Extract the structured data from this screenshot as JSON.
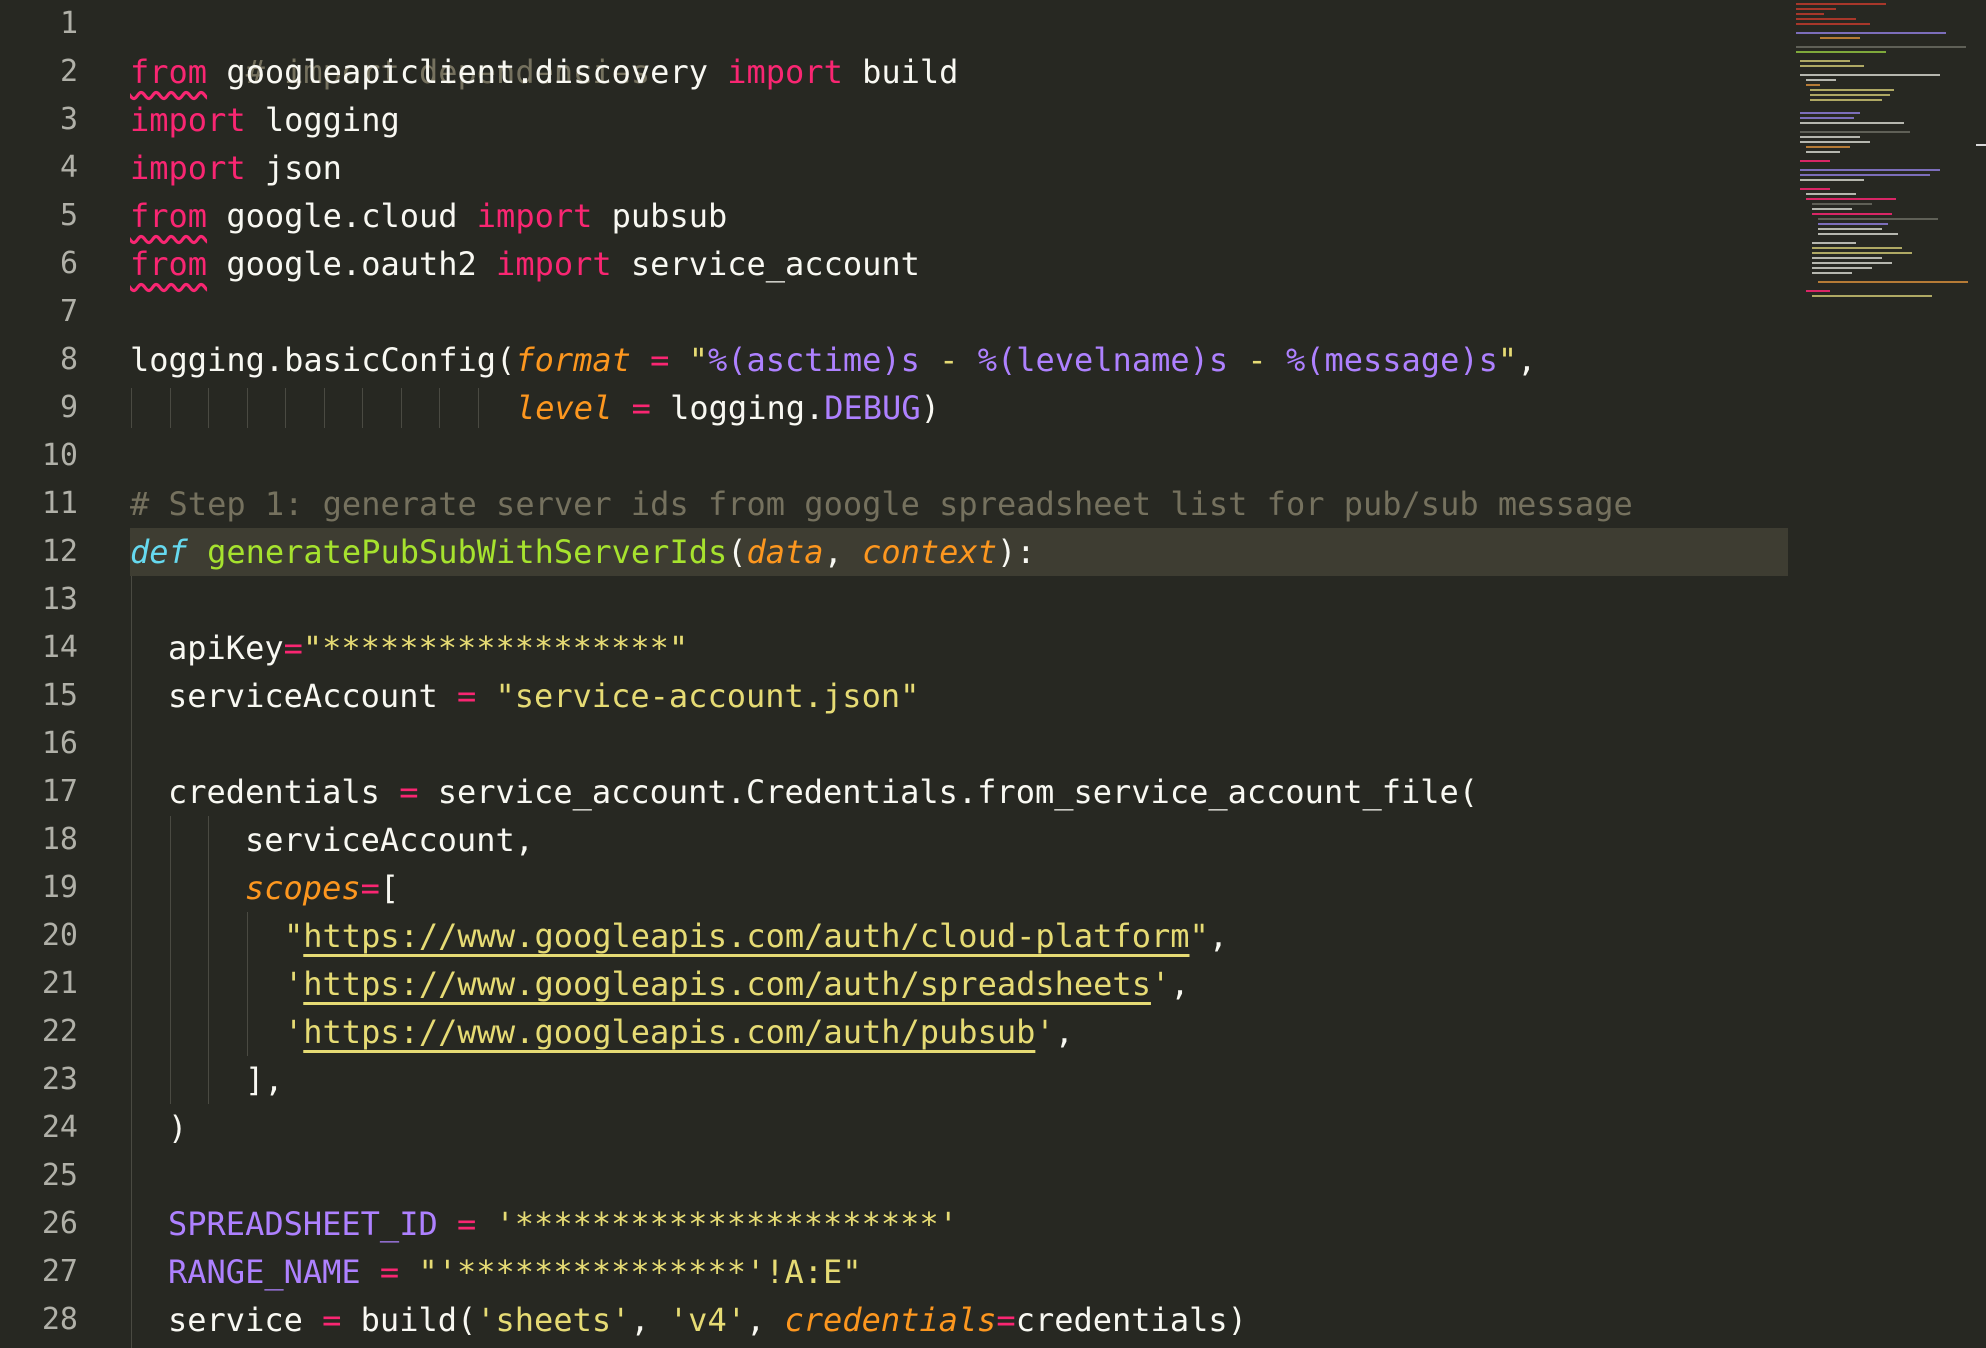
{
  "editor": {
    "language": "python",
    "theme": "monokai",
    "highlighted_line": 12
  },
  "gutter": {
    "line_numbers": [
      "1",
      "2",
      "3",
      "4",
      "5",
      "6",
      "7",
      "8",
      "9",
      "10",
      "11",
      "12",
      "13",
      "14",
      "15",
      "16",
      "17",
      "18",
      "19",
      "20",
      "21",
      "22",
      "23",
      "24",
      "25",
      "26",
      "27",
      "28"
    ]
  },
  "code": {
    "l1_comment": "# import dependencies",
    "l2": {
      "from": "from",
      "mod": " googleapiclient.discovery ",
      "import": "import",
      "name": " build"
    },
    "l3": {
      "import": "import",
      "name": " logging"
    },
    "l4": {
      "import": "import",
      "name": " json"
    },
    "l5": {
      "from": "from",
      "mod": " google.cloud ",
      "import": "import",
      "name": " pubsub"
    },
    "l6": {
      "from": "from",
      "mod": " google.oauth2 ",
      "import": "import",
      "name": " service_account"
    },
    "l8": {
      "call": "logging.basicConfig(",
      "param": "format",
      "eq": " = ",
      "q1": "\"",
      "fmt1": "%(asctime)s",
      "dash1": " - ",
      "fmt2": "%(levelname)s",
      "dash2": " - ",
      "fmt3": "%(message)s",
      "q2": "\"",
      "tail": ","
    },
    "l9": {
      "param": "level",
      "eq": " = ",
      "obj": "logging.",
      "const": "DEBUG",
      "tail": ")"
    },
    "l11_comment": "# Step 1: generate server ids from google spreadsheet list for pub/sub message",
    "l12": {
      "def": "def",
      "name": "generatePubSubWithServerIds",
      "open": "(",
      "p1": "data",
      "comma": ", ",
      "p2": "context",
      "close": "):"
    },
    "l14": {
      "var": "apiKey",
      "eq": "=",
      "str": "\"******************\""
    },
    "l15": {
      "var": "serviceAccount",
      "eq": " = ",
      "str": "\"service-account.json\""
    },
    "l17": {
      "var": "credentials",
      "eq": " = ",
      "call": "service_account.Credentials.from_service_account_file("
    },
    "l18": {
      "text": "serviceAccount,"
    },
    "l19": {
      "param": "scopes",
      "eq": "=",
      "tail": "["
    },
    "l20": {
      "q1": "\"",
      "url": "https://www.googleapis.com/auth/cloud-platform",
      "q2": "\"",
      "tail": ","
    },
    "l21": {
      "q1": "'",
      "url": "https://www.googleapis.com/auth/spreadsheets",
      "q2": "'",
      "tail": ","
    },
    "l22": {
      "q1": "'",
      "url": "https://www.googleapis.com/auth/pubsub",
      "q2": "'",
      "tail": ","
    },
    "l23": {
      "text": "],"
    },
    "l24": {
      "text": ")"
    },
    "l26": {
      "const": "SPREADSHEET_ID",
      "eq": " = ",
      "str": "'**********************'"
    },
    "l27": {
      "const": "RANGE_NAME",
      "eq": " = ",
      "str": "\"'***************'!A:E\""
    },
    "l28": {
      "var": "service",
      "eq": " = ",
      "call": "build(",
      "s1": "'sheets'",
      "c1": ", ",
      "s2": "'v4'",
      "c2": ", ",
      "param": "credentials",
      "eq2": "=",
      "tail": "credentials)"
    }
  },
  "colors": {
    "background": "#272822",
    "keyword": "#f92672",
    "comment": "#75715e",
    "string": "#e6db74",
    "constant": "#ae81ff",
    "parameter": "#fd971f",
    "function": "#a6e22e",
    "def": "#66d9ef",
    "line_highlight": "#3e3d32"
  }
}
